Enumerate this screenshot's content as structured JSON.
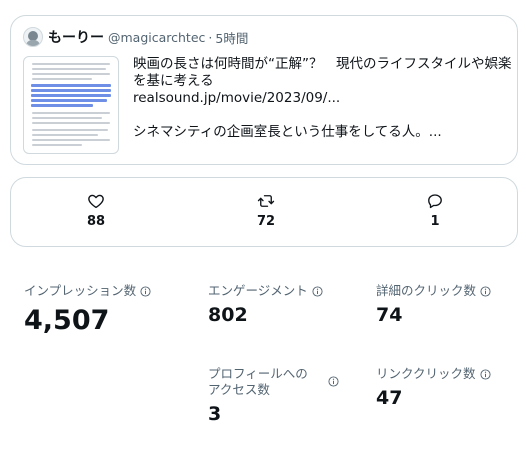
{
  "tweet": {
    "author_name": "もーりー",
    "handle": "@magicarchtec",
    "separator": "·",
    "time": "5時間",
    "title_line1": "映画の長さは何時間が“正解”？　現代のライフスタイルや娯楽",
    "title_line2": "を基に考える",
    "link": "realsound.jp/movie/2023/09/...",
    "snippet": "シネマシティの企画室長という仕事をしてる人。..."
  },
  "engagement": {
    "likes": "88",
    "retweets": "72",
    "replies": "1"
  },
  "stats": {
    "impressions": {
      "label": "インプレッション数",
      "value": "4,507"
    },
    "engagements": {
      "label": "エンゲージメント",
      "value": "802"
    },
    "detail_clicks": {
      "label": "詳細のクリック数",
      "value": "74"
    },
    "profile_visits": {
      "label": "プロフィールへのアクセス数",
      "value": "3"
    },
    "link_clicks": {
      "label": "リンククリック数",
      "value": "47"
    }
  },
  "colors": {
    "border": "#cfd9de",
    "secondary_text": "#536471",
    "primary_text": "#0f1419"
  },
  "icons": [
    "heart-icon",
    "retweet-icon",
    "reply-icon",
    "info-icon"
  ]
}
